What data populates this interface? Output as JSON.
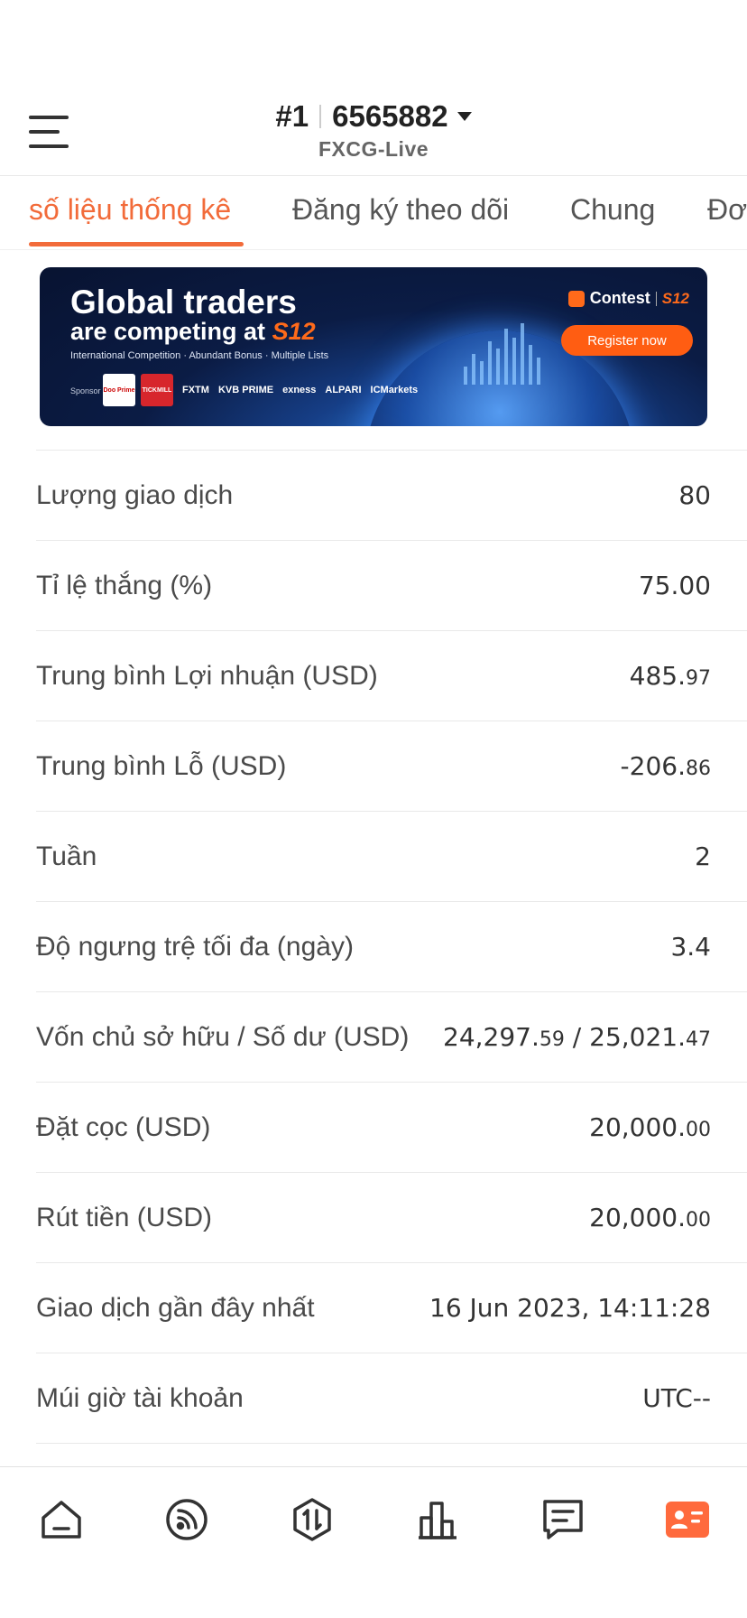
{
  "header": {
    "rank": "#1",
    "account_number": "6565882",
    "server": "FXCG-Live"
  },
  "tabs": [
    {
      "label": "số liệu thống kê",
      "active": true
    },
    {
      "label": "Đăng ký theo dõi",
      "active": false
    },
    {
      "label": "Chung",
      "active": false
    },
    {
      "label": "Đơn",
      "active": false
    }
  ],
  "banner": {
    "title_line1": "Global traders",
    "title_line2": "are competing at",
    "brand": "S12",
    "subtitle": "International Competition · Abundant Bonus · Multiple Lists",
    "sponsor_label": "Sponsor",
    "sponsors": [
      "Doo Prime",
      "TICKMILL",
      "FXTM",
      "KVB PRIME",
      "exness",
      "ALPARI",
      "ICMarkets"
    ],
    "contest_label": "Contest",
    "register_label": "Register now"
  },
  "stats": [
    {
      "label": "Lượng giao dịch",
      "value": "80"
    },
    {
      "label": "Tỉ lệ thắng (%)",
      "value": "75.00"
    },
    {
      "label": "Trung bình Lợi nhuận (USD)",
      "value_main": "485.",
      "value_dec": "97"
    },
    {
      "label": "Trung bình Lỗ (USD)",
      "value_main": "-206.",
      "value_dec": "86"
    },
    {
      "label": "Tuần",
      "value": "2"
    },
    {
      "label": "Độ ngưng trệ tối đa (ngày)",
      "value": "3.4"
    },
    {
      "label": "Vốn chủ sở hữu / Số dư (USD)",
      "value_main": "24,297.",
      "value_dec": "59",
      "value_main2": " / 25,021.",
      "value_dec2": "47"
    },
    {
      "label": "Đặt cọc (USD)",
      "value_main": "20,000.",
      "value_dec": "00"
    },
    {
      "label": "Rút tiền (USD)",
      "value_main": "20,000.",
      "value_dec": "00"
    },
    {
      "label": "Giao dịch gần đây nhất",
      "value": "16 Jun 2023, 14:11:28"
    },
    {
      "label": "Múi giờ tài khoản",
      "value": "UTC--"
    }
  ],
  "bottom_nav": [
    {
      "icon": "home-icon"
    },
    {
      "icon": "feed-icon"
    },
    {
      "icon": "trade-icon"
    },
    {
      "icon": "chart-icon"
    },
    {
      "icon": "message-icon"
    },
    {
      "icon": "profile-card-icon",
      "active": true
    }
  ],
  "colors": {
    "accent": "#f26b3a",
    "active_nav": "#ff6a3d",
    "nav_icon": "#333333"
  }
}
